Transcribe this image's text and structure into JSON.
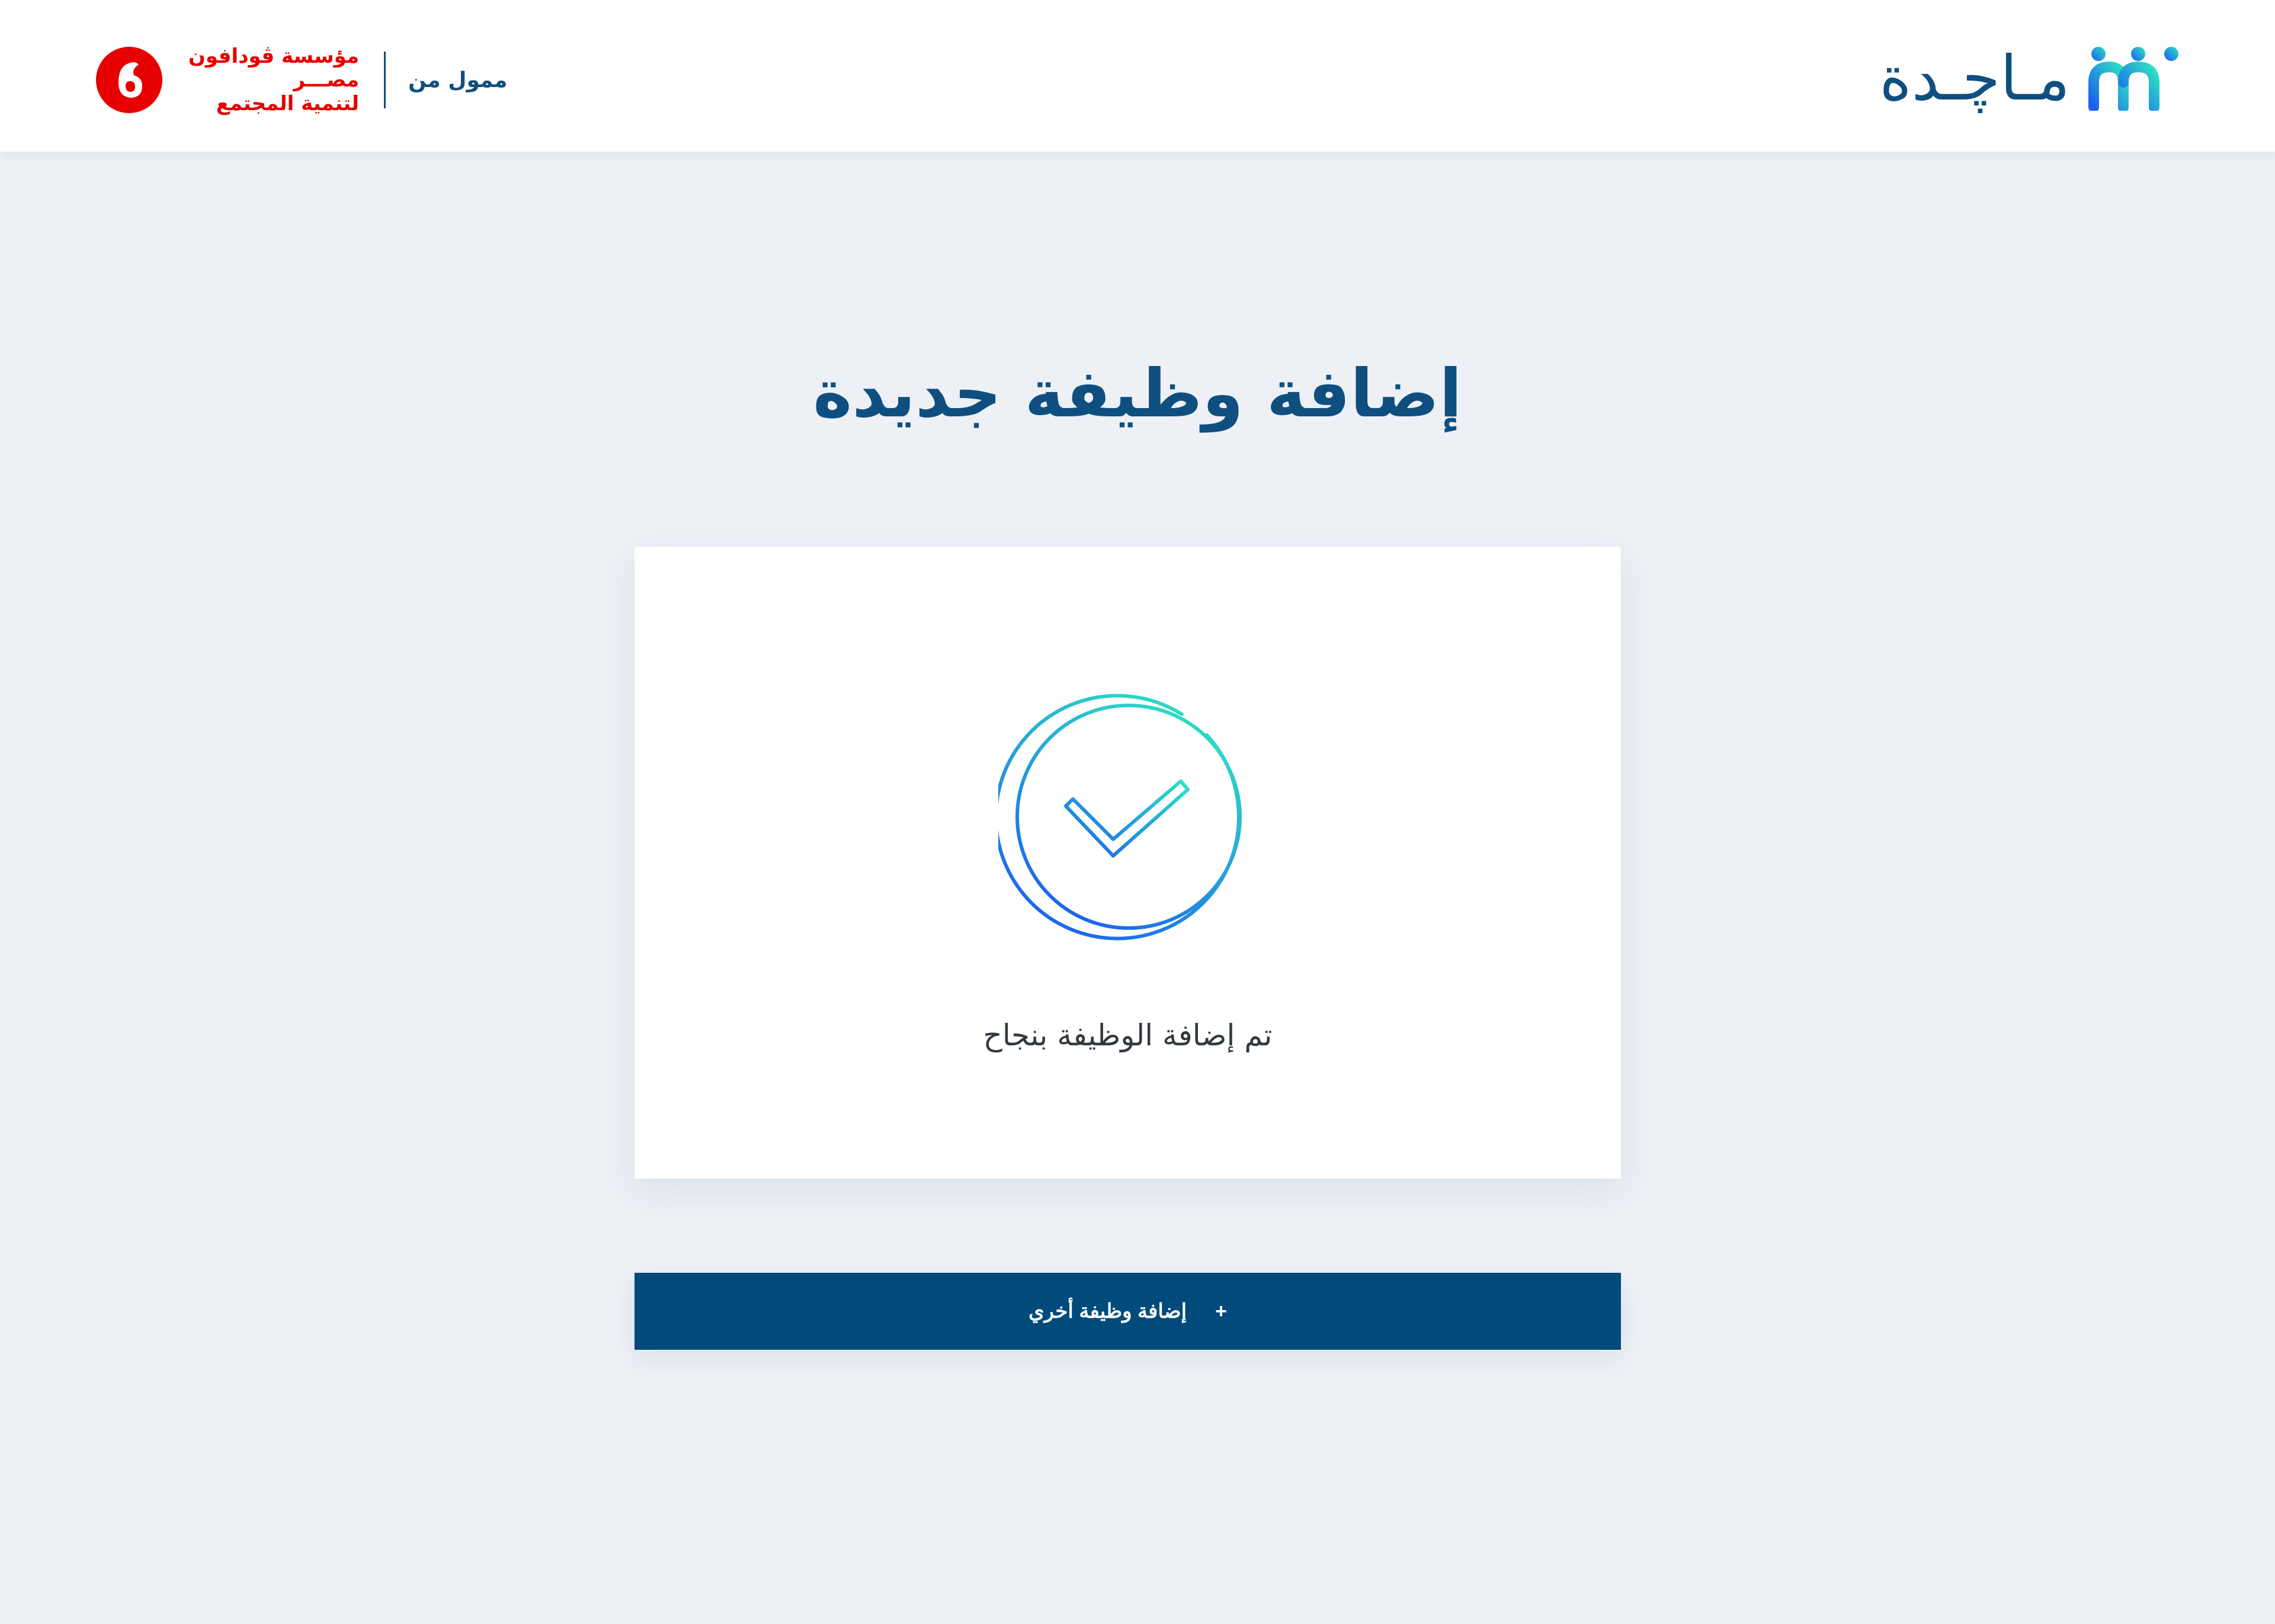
{
  "header": {
    "brand_name": "مـاچـدة",
    "brand_logo_icon": "majda-people-logo-icon",
    "funded_by": "ممول من",
    "funder": {
      "lines": [
        "مؤسسة ڤودافون",
        "مصـــر",
        "لتنمية المجتمع"
      ],
      "logo_icon": "vodafone-logo-icon"
    }
  },
  "page": {
    "title": "إضافة وظيفة جديدة"
  },
  "card": {
    "icon": "success-check-circle-icon",
    "message": "تم إضافة الوظيفة بنجاح"
  },
  "actions": {
    "add_another_label": "إضافة وظيفة أخري",
    "add_another_icon": "+"
  },
  "colors": {
    "primary": "#004a7c",
    "title": "#0f4f80",
    "background": "#edf0f5",
    "vodafone_red": "#e60000",
    "success_gradient_start": "#2ee3c3",
    "success_gradient_end": "#1b5ef0"
  }
}
